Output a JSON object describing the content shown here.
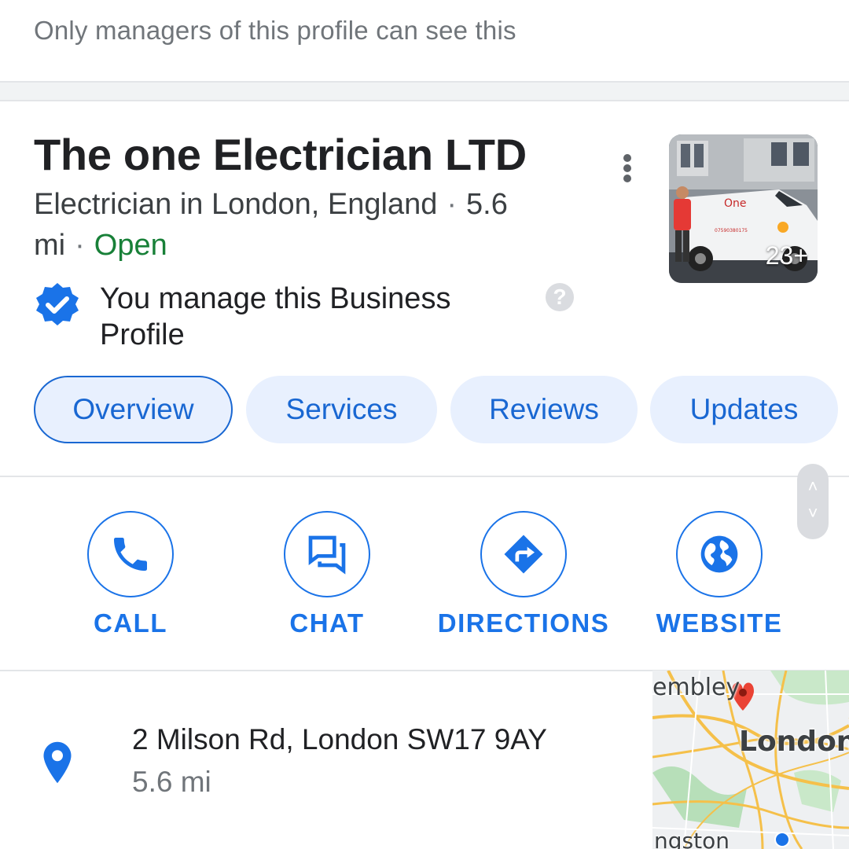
{
  "notice": {
    "text": "Only managers of this profile can see this"
  },
  "business": {
    "name": "The one Electrician LTD",
    "category": "Electrician in London, England",
    "distance": "5.6 mi",
    "status": "Open",
    "photo_count": "23+",
    "manage_text": "You manage this Business Profile",
    "help_symbol": "?"
  },
  "tabs": [
    {
      "label": "Overview",
      "active": true
    },
    {
      "label": "Services",
      "active": false
    },
    {
      "label": "Reviews",
      "active": false
    },
    {
      "label": "Updates",
      "active": false
    }
  ],
  "actions": [
    {
      "label": "CALL",
      "icon": "phone-icon"
    },
    {
      "label": "CHAT",
      "icon": "chat-icon"
    },
    {
      "label": "DIRECTIONS",
      "icon": "directions-icon"
    },
    {
      "label": "WEBSITE",
      "icon": "globe-icon"
    }
  ],
  "location": {
    "address": "2 Milson Rd, London SW17 9AY",
    "distance": "5.6 mi",
    "icon": "location-pin-icon"
  },
  "map": {
    "labels": [
      "embley",
      "London",
      "ngston"
    ]
  },
  "colors": {
    "accent": "#1a73e8",
    "chip_bg": "#e8f0fe",
    "open": "#188038",
    "pin": "#ea4335"
  }
}
